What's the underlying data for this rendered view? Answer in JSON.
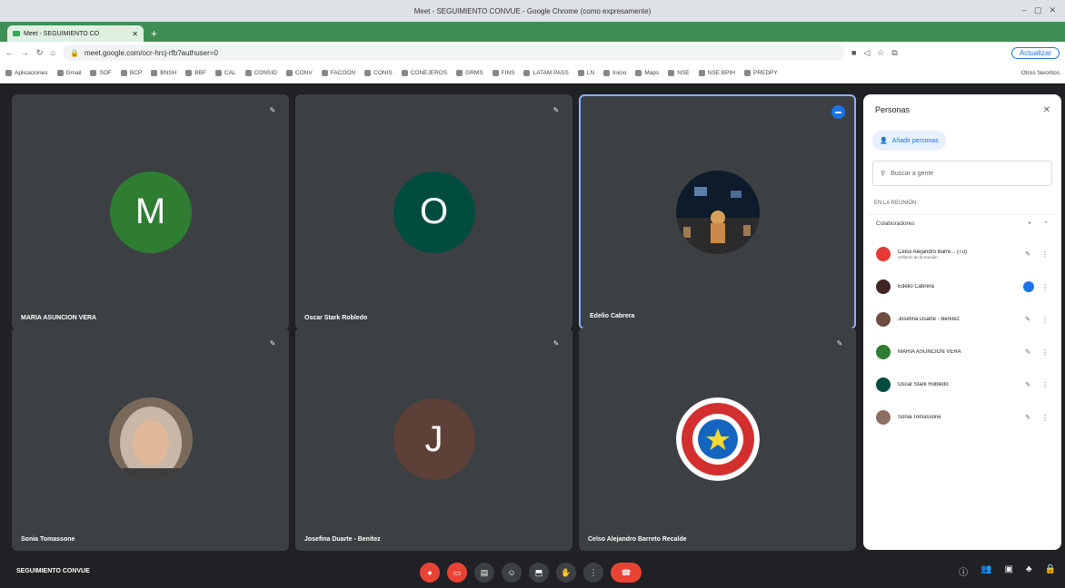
{
  "window": {
    "title": "Meet - SEGUIMIENTO CONVUE - Google Chrome (como expresamente)"
  },
  "tab": {
    "label": "Meet - SEGUIMIENTO CO"
  },
  "address": {
    "url": "meet.google.com/ocr-hrcj-rfb?authuser=0",
    "update_label": "Actualizar"
  },
  "bookmarks": {
    "items": [
      "Aplicaciones",
      "Gmail",
      "SOF",
      "BCP",
      "BNSH",
      "BBF",
      "CAL",
      "CONSID",
      "CONV",
      "FACOON",
      "CONIS",
      "CONEJEROS",
      "GRMS",
      "FINS",
      "LATAM PASS",
      "LN",
      "Inicio",
      "Maps",
      "NSE",
      "NSE BPIH",
      "PREDPY"
    ],
    "other": "Otros favoritos"
  },
  "tiles": [
    {
      "name": "MARIA ASUNCION VERA",
      "initial": "M",
      "color": "#2e7d32"
    },
    {
      "name": "Oscar Stark Robledo",
      "initial": "O",
      "color": "#004d40"
    },
    {
      "name": "Edelio Cabrera",
      "initial": "",
      "color": ""
    },
    {
      "name": "Sonia Tomassone",
      "initial": "",
      "color": ""
    },
    {
      "name": "Josefina Duarte - Benítez",
      "initial": "J",
      "color": "#5d4037"
    },
    {
      "name": "Celso Alejandro Barreto Recalde",
      "initial": "",
      "color": ""
    }
  ],
  "people_panel": {
    "title": "Personas",
    "add_label": "Añadir personas",
    "search_placeholder": "Buscar a gente",
    "section": "EN LA REUNIÓN",
    "collaborators_label": "Colaboradores",
    "people": [
      {
        "name": "Celso Alejandro Barre... (Tú)",
        "sub": "Anfitrión de la reunión",
        "color": "#e53935"
      },
      {
        "name": "Edelio Cabrera",
        "sub": "",
        "color": "#3e2723"
      },
      {
        "name": "Josefina Duarte - Benítez",
        "sub": "",
        "color": "#6d4c41"
      },
      {
        "name": "MARIA ASUNCION VERA",
        "sub": "",
        "color": "#2e7d32"
      },
      {
        "name": "Oscar Stark Robledo",
        "sub": "",
        "color": "#004d40"
      },
      {
        "name": "Sonia Tomassone",
        "sub": "",
        "color": "#8d6e63"
      }
    ]
  },
  "bottom": {
    "meeting_name": "SEGUIMIENTO CONVUE"
  },
  "colors": {
    "accent": "#1a73e8",
    "danger": "#ea4335",
    "tile": "#3c4043",
    "background": "#202124"
  }
}
